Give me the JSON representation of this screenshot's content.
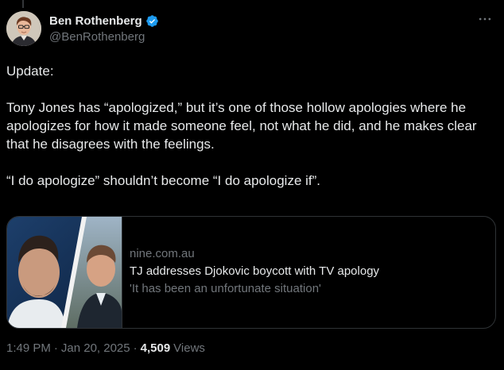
{
  "author": {
    "display_name": "Ben Rothenberg",
    "handle": "@BenRothenberg",
    "verified": true
  },
  "colors": {
    "background": "#000000",
    "text": "#e7e9ea",
    "secondary": "#71767b",
    "verified_blue": "#1d9bf0",
    "border": "#2f3336"
  },
  "icons": {
    "more": "more-horizontal-icon",
    "verified": "verified-badge-icon"
  },
  "tweet": {
    "paragraphs": [
      "Update:",
      "Tony Jones has “apologized,” but it’s one of those hollow apologies where he apologizes for how it made someone feel, not what he did, and he makes clear that he disagrees with the feelings.",
      "“I do apologize” shouldn’t become “I do apologize if”."
    ]
  },
  "link_card": {
    "domain": "nine.com.au",
    "title": "TJ addresses Djokovic boycott with TV apology",
    "description": "'It has been an unfortunate situation'"
  },
  "meta": {
    "time": "1:49 PM",
    "separator": "·",
    "date": "Jan 20, 2025",
    "views_count": "4,509",
    "views_label": "Views"
  }
}
